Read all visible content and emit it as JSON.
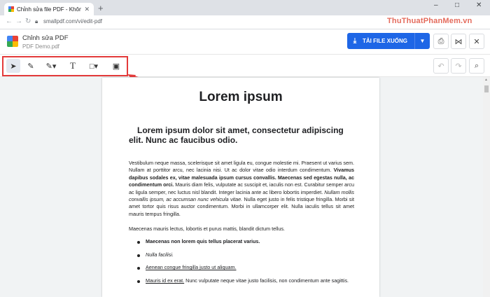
{
  "browser": {
    "tab_title": "Chỉnh sửa file PDF - Không ảnh l",
    "url": "smallpdf.com/vi/edit-pdf",
    "window_controls": [
      "–",
      "□",
      "✕"
    ]
  },
  "watermark": "ThuThuatPhanMem.vn",
  "app": {
    "title": "Chỉnh sửa PDF",
    "file_name": "PDF Demo.pdf",
    "download_label": "TẢI FILE XUỐNG",
    "accent": "#1e66e6"
  },
  "toolbar": {
    "tools": [
      "select-icon",
      "pencil-icon",
      "highlighter-icon",
      "text-icon",
      "shape-icon",
      "image-icon"
    ]
  },
  "document": {
    "title": "Lorem ipsum",
    "subtitle": "Lorem ipsum dolor sit amet, consectetur adipiscing elit. Nunc ac faucibus odio.",
    "para1_a": "Vestibulum neque massa, scelerisque sit amet ligula eu, congue molestie mi. Praesent ut varius sem. Nullam at porttitor arcu, nec lacinia nisi. Ut ac dolor vitae odio interdum condimentum. ",
    "para1_b": "Vivamus dapibus sodales ex, vitae malesuada ipsum cursus convallis. Maecenas sed egestas nulla, ac condimentum orci.",
    "para1_c": " Mauris diam felis, vulputate ac suscipit et, iaculis non est. Curabitur semper arcu ac ligula semper, nec luctus nisl blandit. Integer lacinia ante ac libero lobortis imperdiet. ",
    "para1_d": "Nullam mollis convallis ipsum, ac accumsan nunc vehicula vitae.",
    "para1_e": " Nulla eget justo in felis tristique fringilla. Morbi sit amet tortor quis risus auctor condimentum. Morbi in ullamcorper elit. Nulla iaculis tellus sit amet mauris tempus fringilla.",
    "para2": "Maecenas mauris lectus, lobortis et purus mattis, blandit dictum tellus.",
    "bullet1": "Maecenas non lorem quis tellus placerat varius.",
    "bullet2": "Nulla facilisi.",
    "bullet3": "Aenean congue fringilla justo ut aliquam.",
    "bullet4_a": "Mauris id ex erat.",
    "bullet4_b": " Nunc vulputate neque vitae justo facilisis, non condimentum ante sagittis."
  }
}
